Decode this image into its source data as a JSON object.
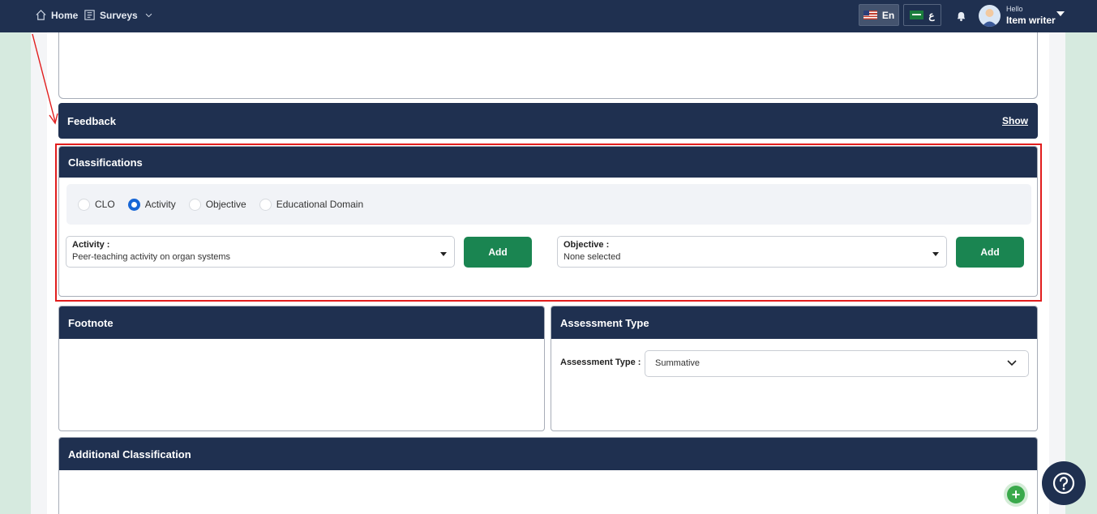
{
  "nav": {
    "home": "Home",
    "surveys": "Surveys"
  },
  "lang": {
    "en": "En",
    "ar": "ع"
  },
  "user": {
    "greeting": "Hello",
    "name": "Item writer"
  },
  "feedback": {
    "title": "Feedback",
    "show": "Show"
  },
  "classifications": {
    "title": "Classifications",
    "options": [
      "CLO",
      "Activity",
      "Objective",
      "Educational Domain"
    ],
    "selected": "Activity",
    "activity_label": "Activity :",
    "activity_value": "Peer-teaching activity on organ systems",
    "objective_label": "Objective :",
    "objective_value": "None selected",
    "add_label": "Add"
  },
  "footnote": {
    "title": "Footnote"
  },
  "assessment": {
    "title": "Assessment Type",
    "label": "Assessment Type :",
    "value": "Summative"
  },
  "additional": {
    "title": "Additional Classification"
  },
  "colors": {
    "navy": "#1f3050",
    "green": "#1a8551",
    "highlight": "#e11d1d",
    "radio_active": "#1766d6"
  }
}
